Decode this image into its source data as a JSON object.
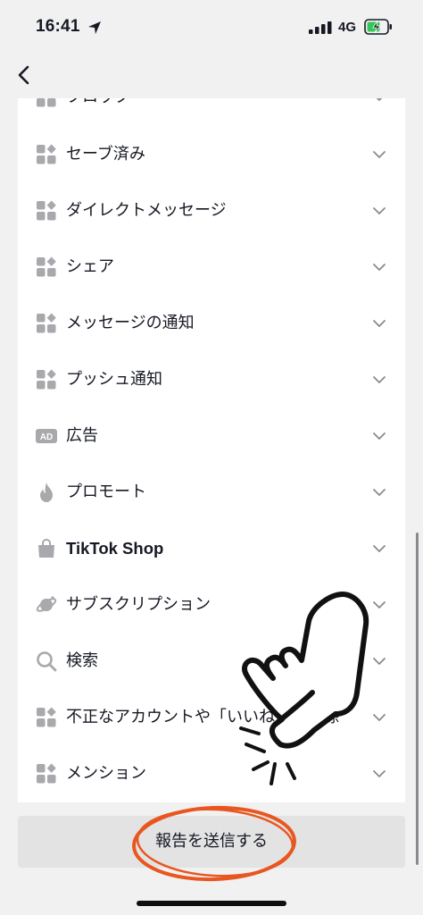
{
  "status_bar": {
    "time": "16:41",
    "network": "4G",
    "location_icon": "location-arrow-icon",
    "signal_icon": "signal-bars-icon",
    "battery_icon": "battery-charging-icon"
  },
  "nav": {
    "back_icon": "chevron-left-icon"
  },
  "list": {
    "items": [
      {
        "label": "ブロック",
        "icon": "grid-icon"
      },
      {
        "label": "セーブ済み",
        "icon": "grid-icon"
      },
      {
        "label": "ダイレクトメッセージ",
        "icon": "grid-icon"
      },
      {
        "label": "シェア",
        "icon": "grid-icon"
      },
      {
        "label": "メッセージの通知",
        "icon": "grid-icon"
      },
      {
        "label": "プッシュ通知",
        "icon": "grid-icon"
      },
      {
        "label": "広告",
        "icon": "ad-badge-icon",
        "badge": "AD"
      },
      {
        "label": "プロモート",
        "icon": "flame-icon"
      },
      {
        "label": "TikTok Shop",
        "icon": "shopping-bag-icon"
      },
      {
        "label": "サブスクリプション",
        "icon": "planet-icon"
      },
      {
        "label": "検索",
        "icon": "search-icon"
      },
      {
        "label": "不正なアカウントや「いいね」の削除",
        "icon": "grid-icon"
      },
      {
        "label": "メンション",
        "icon": "grid-icon"
      }
    ]
  },
  "submit": {
    "label": "報告を送信する"
  },
  "overlay": {
    "hand_icon": "pointing-hand-icon",
    "highlight": "orange-circle-annotation"
  },
  "colors": {
    "accent": "#e8571f",
    "icon_gray": "#a8a8ad",
    "text": "#161823"
  }
}
